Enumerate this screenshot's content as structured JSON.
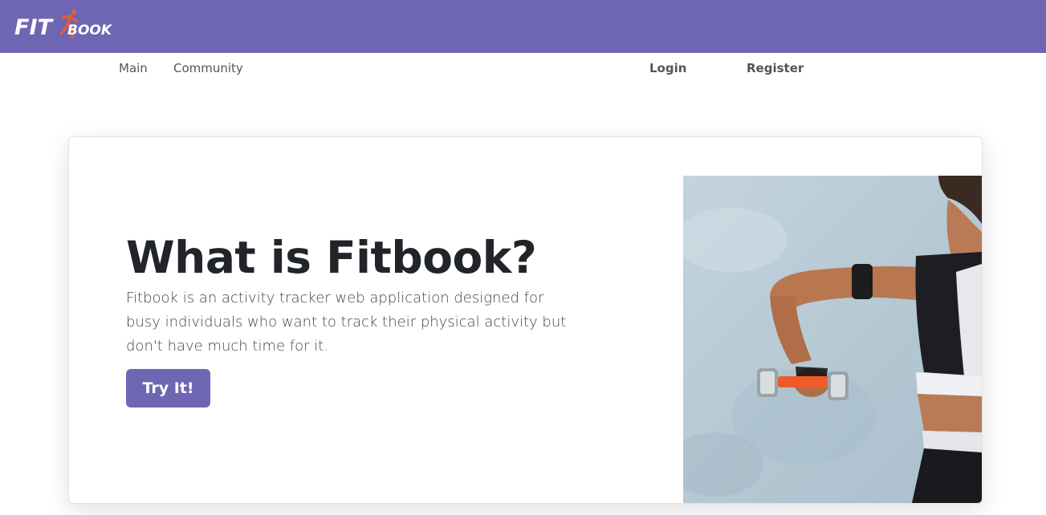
{
  "brand": {
    "logo_fit": "FIT",
    "logo_book": "BOOK",
    "logo_icon": "running-figure-icon",
    "brand_color": "#6f66b3",
    "accent_color": "#f05a28"
  },
  "nav": {
    "main": "Main",
    "community": "Community",
    "login": "Login",
    "register": "Register"
  },
  "hero": {
    "title": "What is Fitbook?",
    "description": "Fitbook is an activity tracker web application designed for busy individuals who want to track their physical activity but don't have much time for it.",
    "cta_label": "Try It!",
    "image_subject": "woman-lifting-dumbbell-photo"
  }
}
